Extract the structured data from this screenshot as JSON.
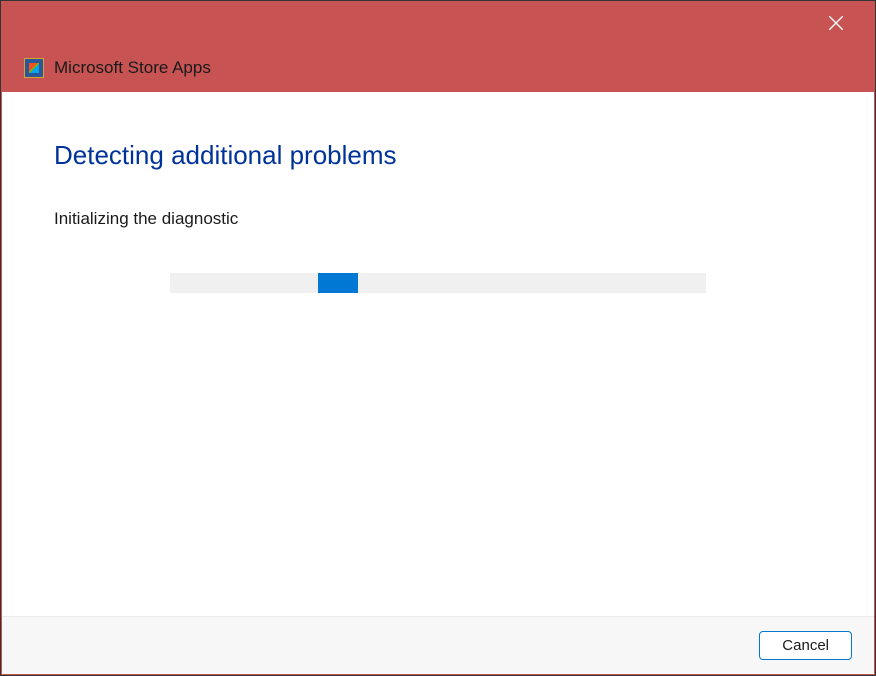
{
  "titlebar": {
    "app_name": "Microsoft Store Apps"
  },
  "content": {
    "heading": "Detecting additional problems",
    "status": "Initializing the diagnostic"
  },
  "footer": {
    "cancel_label": "Cancel"
  },
  "colors": {
    "titlebar_bg": "#c85353",
    "heading_text": "#003399",
    "progress_fill": "#0078d4"
  }
}
